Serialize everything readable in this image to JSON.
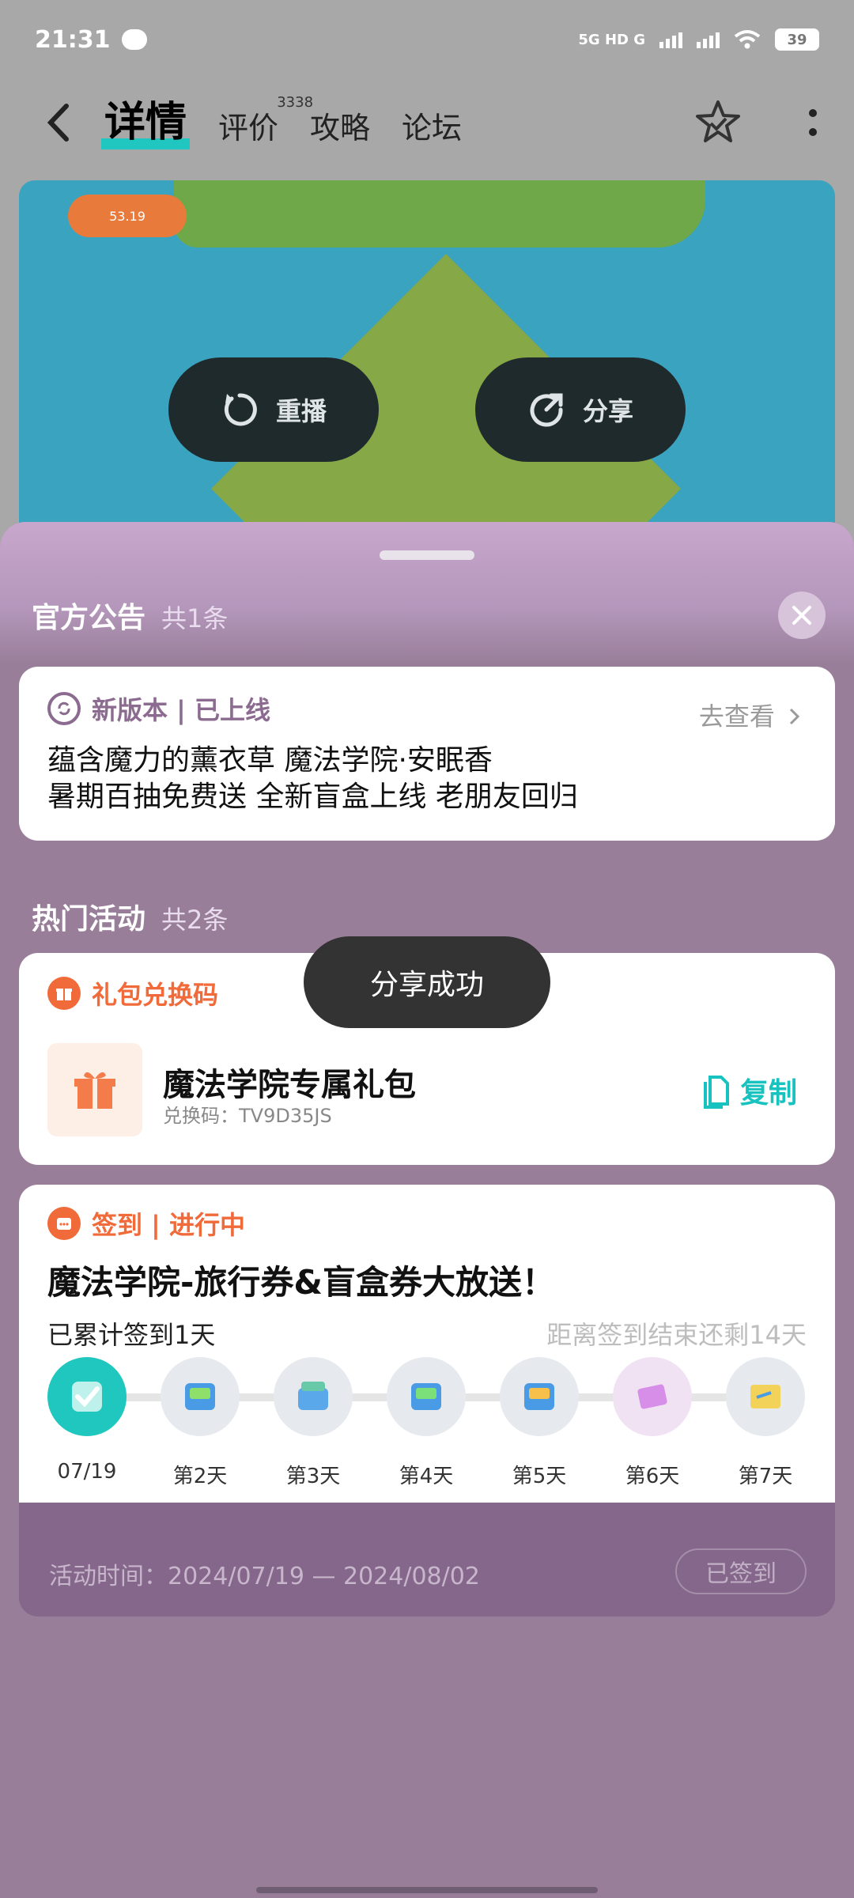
{
  "status": {
    "time": "21:31",
    "network": "5G HD G",
    "battery": "39"
  },
  "nav": {
    "tabs": [
      {
        "label": "详情"
      },
      {
        "label": "评价",
        "badge": "3338"
      },
      {
        "label": "攻略"
      },
      {
        "label": "论坛"
      }
    ]
  },
  "video": {
    "hud_value": "53.19",
    "replay_label": "重播",
    "share_label": "分享"
  },
  "announcement": {
    "title": "官方公告",
    "count": "共1条",
    "tag": "新版本 | 已上线",
    "link": "去查看",
    "lines": [
      "蕴含魔力的薰衣草 魔法学院·安眠香",
      "暑期百抽免费送 全新盲盒上线 老朋友回归"
    ]
  },
  "activities": {
    "title": "热门活动",
    "count": "共2条"
  },
  "gift": {
    "tag": "礼包兑换码",
    "name": "魔法学院专属礼包",
    "code_label": "兑换码：",
    "code": "TV9D35JS",
    "copy_label": "复制"
  },
  "checkin": {
    "tag": "签到 | 进行中",
    "title": "魔法学院-旅行券&盲盒券大放送！",
    "accumulated": "已累计签到1天",
    "remaining": "距离签到结束还剩14天",
    "days": [
      "07/19",
      "第2天",
      "第3天",
      "第4天",
      "第5天",
      "第6天",
      "第7天"
    ],
    "period_label": "活动时间：",
    "period": "2024/07/19 — 2024/08/02",
    "signed_label": "已签到"
  },
  "toast": "分享成功",
  "colors": {
    "accent": "#1fc7bf",
    "orange": "#f06a3a",
    "sheet": "#997e99"
  }
}
